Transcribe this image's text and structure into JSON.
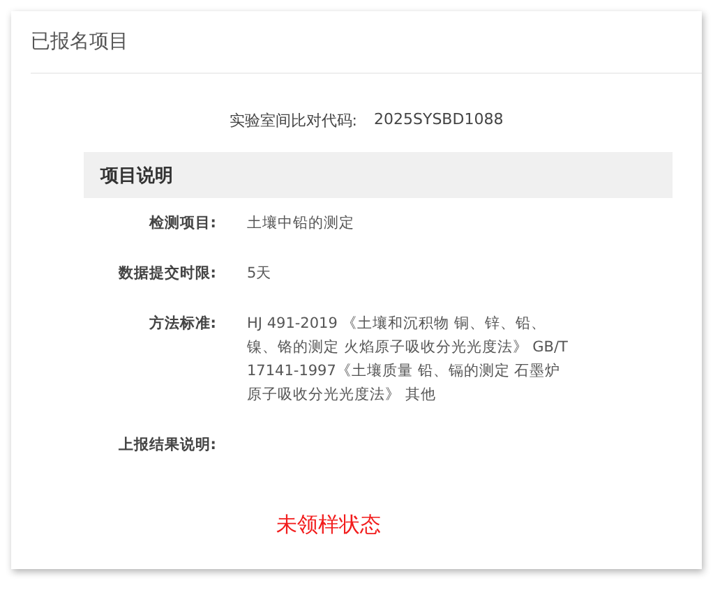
{
  "panel_title": "已报名项目",
  "lab_code": {
    "label": "实验室间比对代码:",
    "value": "2025SYSBD1088"
  },
  "section": {
    "title": "项目说明",
    "fields": [
      {
        "label": "检测项目:",
        "value": "土壤中铅的测定"
      },
      {
        "label": "数据提交时限:",
        "value": "5天"
      },
      {
        "label": "方法标准:",
        "value": "HJ 491-2019 《土壤和沉积物 铜、锌、铅、镍、铬的测定 火焰原子吸收分光光度法》 GB/T 17141-1997《土壤质量 铅、镉的测定 石墨炉原子吸收分光光度法》 其他"
      },
      {
        "label": "上报结果说明:"
      }
    ]
  },
  "annotation": "未领样状态"
}
